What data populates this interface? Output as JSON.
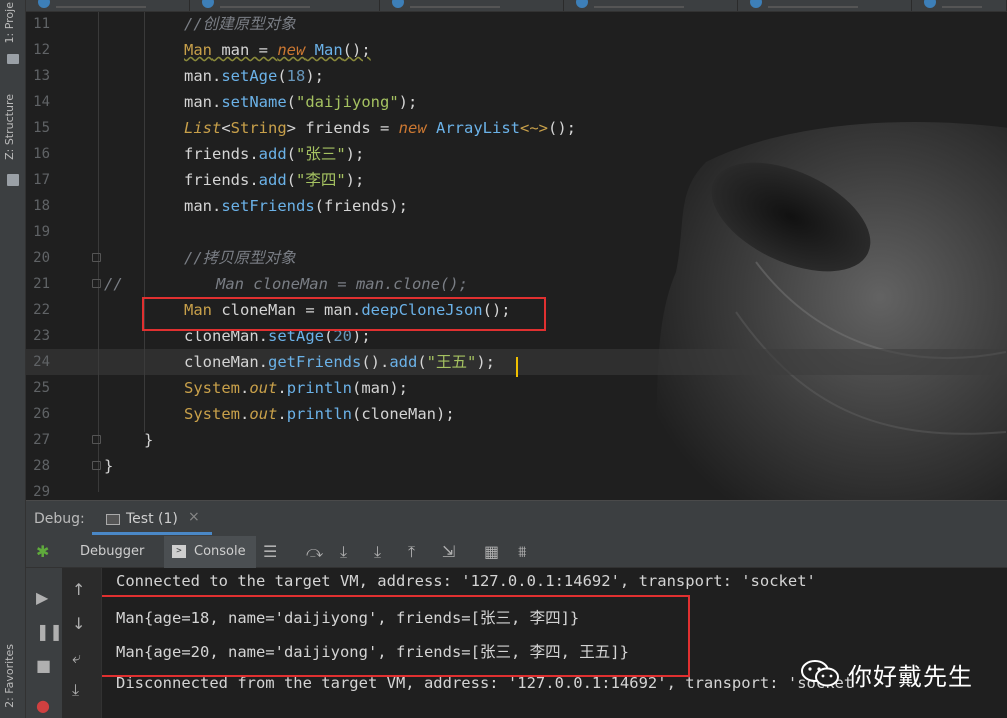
{
  "left_strip": {
    "project_tab": "1: Proje",
    "structure_tab": "Z: Structure",
    "favorites_tab": "2: Favorites"
  },
  "editor": {
    "lines": [
      {
        "n": "11",
        "tokens": [
          [
            "cm",
            "//创建原型对象"
          ]
        ]
      },
      {
        "n": "12",
        "tokens": [
          [
            "ty wavy",
            "Man"
          ],
          [
            "pl wavy",
            " man = "
          ],
          [
            "kw-i wavy",
            "new"
          ],
          [
            "pl wavy",
            " "
          ],
          [
            "fn wavy",
            "Man"
          ],
          [
            "pl wavy",
            "();"
          ]
        ]
      },
      {
        "n": "13",
        "tokens": [
          [
            "pl",
            "man."
          ],
          [
            "fn",
            "setAge"
          ],
          [
            "pl",
            "("
          ],
          [
            "num",
            "18"
          ],
          [
            "pl",
            ");"
          ]
        ]
      },
      {
        "n": "14",
        "tokens": [
          [
            "pl",
            "man."
          ],
          [
            "fn",
            "setName"
          ],
          [
            "pl",
            "("
          ],
          [
            "str",
            "\"daijiyong\""
          ],
          [
            "pl",
            ");"
          ]
        ]
      },
      {
        "n": "15",
        "tokens": [
          [
            "ty-i",
            "List"
          ],
          [
            "pl",
            "<"
          ],
          [
            "ty",
            "String"
          ],
          [
            "pl",
            "> friends = "
          ],
          [
            "kw-i",
            "new"
          ],
          [
            "pl",
            " "
          ],
          [
            "fn",
            "ArrayList"
          ],
          [
            "ty",
            "<~>"
          ],
          [
            "pl",
            "();"
          ]
        ]
      },
      {
        "n": "16",
        "tokens": [
          [
            "pl",
            "friends."
          ],
          [
            "fn",
            "add"
          ],
          [
            "pl",
            "("
          ],
          [
            "str",
            "\"张三\""
          ],
          [
            "pl",
            ");"
          ]
        ]
      },
      {
        "n": "17",
        "tokens": [
          [
            "pl",
            "friends."
          ],
          [
            "fn",
            "add"
          ],
          [
            "pl",
            "("
          ],
          [
            "str",
            "\"李四\""
          ],
          [
            "pl",
            ");"
          ]
        ]
      },
      {
        "n": "18",
        "tokens": [
          [
            "pl",
            "man."
          ],
          [
            "fn",
            "setFriends"
          ],
          [
            "pl",
            "(friends);"
          ]
        ]
      },
      {
        "n": "19",
        "tokens": []
      },
      {
        "n": "20",
        "tokens": [
          [
            "cm",
            "//拷贝原型对象"
          ]
        ]
      },
      {
        "n": "21",
        "tokens": [
          [
            "cm",
            "//          Man cloneMan = man.clone();"
          ]
        ]
      },
      {
        "n": "22",
        "tokens": [
          [
            "ty",
            "Man"
          ],
          [
            "pl",
            " cloneMan = man."
          ],
          [
            "fn",
            "deepCloneJson"
          ],
          [
            "pl",
            "();"
          ]
        ]
      },
      {
        "n": "23",
        "tokens": [
          [
            "pl",
            "cloneMan."
          ],
          [
            "fn",
            "setAge"
          ],
          [
            "pl",
            "("
          ],
          [
            "num",
            "20"
          ],
          [
            "pl",
            ");"
          ]
        ]
      },
      {
        "n": "24",
        "tokens": [
          [
            "pl",
            "cloneMan."
          ],
          [
            "fn",
            "getFriends"
          ],
          [
            "pl",
            "()."
          ],
          [
            "fn",
            "add"
          ],
          [
            "pl",
            "("
          ],
          [
            "str",
            "\"王五\""
          ],
          [
            "pl",
            ");"
          ]
        ]
      },
      {
        "n": "25",
        "tokens": [
          [
            "ty",
            "System"
          ],
          [
            "pl",
            "."
          ],
          [
            "fld",
            "out"
          ],
          [
            "pl",
            "."
          ],
          [
            "fn",
            "println"
          ],
          [
            "pl",
            "(man);"
          ]
        ]
      },
      {
        "n": "26",
        "tokens": [
          [
            "ty",
            "System"
          ],
          [
            "pl",
            "."
          ],
          [
            "fld",
            "out"
          ],
          [
            "pl",
            "."
          ],
          [
            "fn",
            "println"
          ],
          [
            "pl",
            "(cloneMan);"
          ]
        ]
      },
      {
        "n": "27",
        "tokens": [
          [
            "pl",
            "}"
          ]
        ]
      },
      {
        "n": "28",
        "tokens": [
          [
            "pl",
            "}"
          ]
        ]
      },
      {
        "n": "29",
        "tokens": []
      }
    ]
  },
  "debug": {
    "label": "Debug:",
    "run_tab": "Test (1)",
    "close_glyph": "×",
    "debugger_tab": "Debugger",
    "console_tab": "Console"
  },
  "console": {
    "lines": [
      "Connected to the target VM, address: '127.0.0.1:14692', transport: 'socket'",
      "Man{age=18, name='daijiyong', friends=[张三, 李四]}",
      "Man{age=20, name='daijiyong', friends=[张三, 李四, 王五]}",
      "Disconnected from the target VM, address: '127.0.0.1:14692', transport: 'socket'"
    ]
  },
  "watermark": {
    "text": "你好戴先生",
    "icon": "wechat-icon"
  },
  "colors": {
    "editor_bg": "#1f1f1f",
    "panel_bg": "#3c3f41",
    "highlight_box": "#e03030",
    "caret": "#f0c000"
  }
}
